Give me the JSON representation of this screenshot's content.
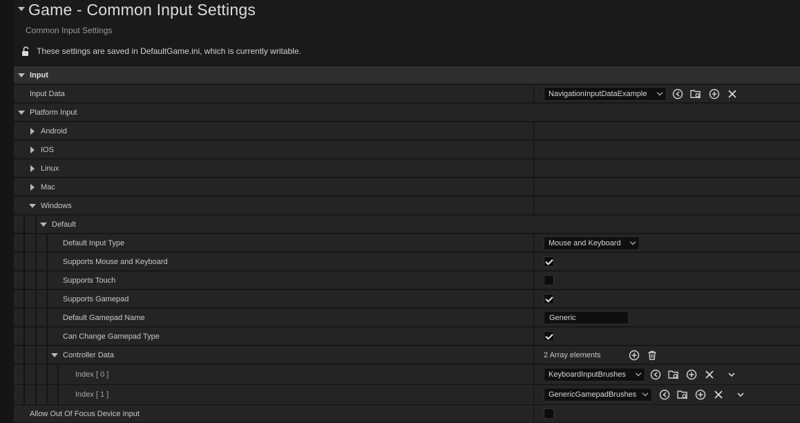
{
  "header": {
    "title": "Game - Common Input Settings",
    "subtitle": "Common Input Settings",
    "notice": "These settings are saved in DefaultGame.ini, which is currently writable."
  },
  "icons": {
    "collapse": "triangle-down-icon",
    "expand": "triangle-right-icon",
    "unlock": "unlock-icon",
    "use-selected": "arrow-left-circle-icon",
    "browse": "folder-search-icon",
    "add": "plus-circle-icon",
    "clear": "close-icon",
    "delete": "trash-icon",
    "more": "chevron-down-icon"
  },
  "sections": {
    "input": "Input",
    "input_data": {
      "label": "Input Data",
      "value": "NavigationInputDataExample"
    },
    "platform_input": "Platform Input",
    "platforms": [
      "Android",
      "IOS",
      "Linux",
      "Mac",
      "Windows"
    ],
    "default": "Default",
    "default_input_type": {
      "label": "Default Input Type",
      "value": "Mouse and Keyboard"
    },
    "supports_mouse_keyboard": {
      "label": "Supports Mouse and Keyboard",
      "checked": true
    },
    "supports_touch": {
      "label": "Supports Touch",
      "checked": false
    },
    "supports_gamepad": {
      "label": "Supports Gamepad",
      "checked": true
    },
    "default_gamepad_name": {
      "label": "Default Gamepad Name",
      "value": "Generic"
    },
    "can_change_gamepad_type": {
      "label": "Can Change Gamepad Type",
      "checked": true
    },
    "controller_data": {
      "label": "Controller Data",
      "count": "2 Array elements",
      "items": [
        {
          "label": "Index [ 0 ]",
          "value": "KeyboardInputBrushes"
        },
        {
          "label": "Index [ 1 ]",
          "value": "GenericGamepadBrushes"
        }
      ]
    },
    "allow_out_of_focus": {
      "label": "Allow Out Of Focus Device Input",
      "checked": false
    }
  }
}
